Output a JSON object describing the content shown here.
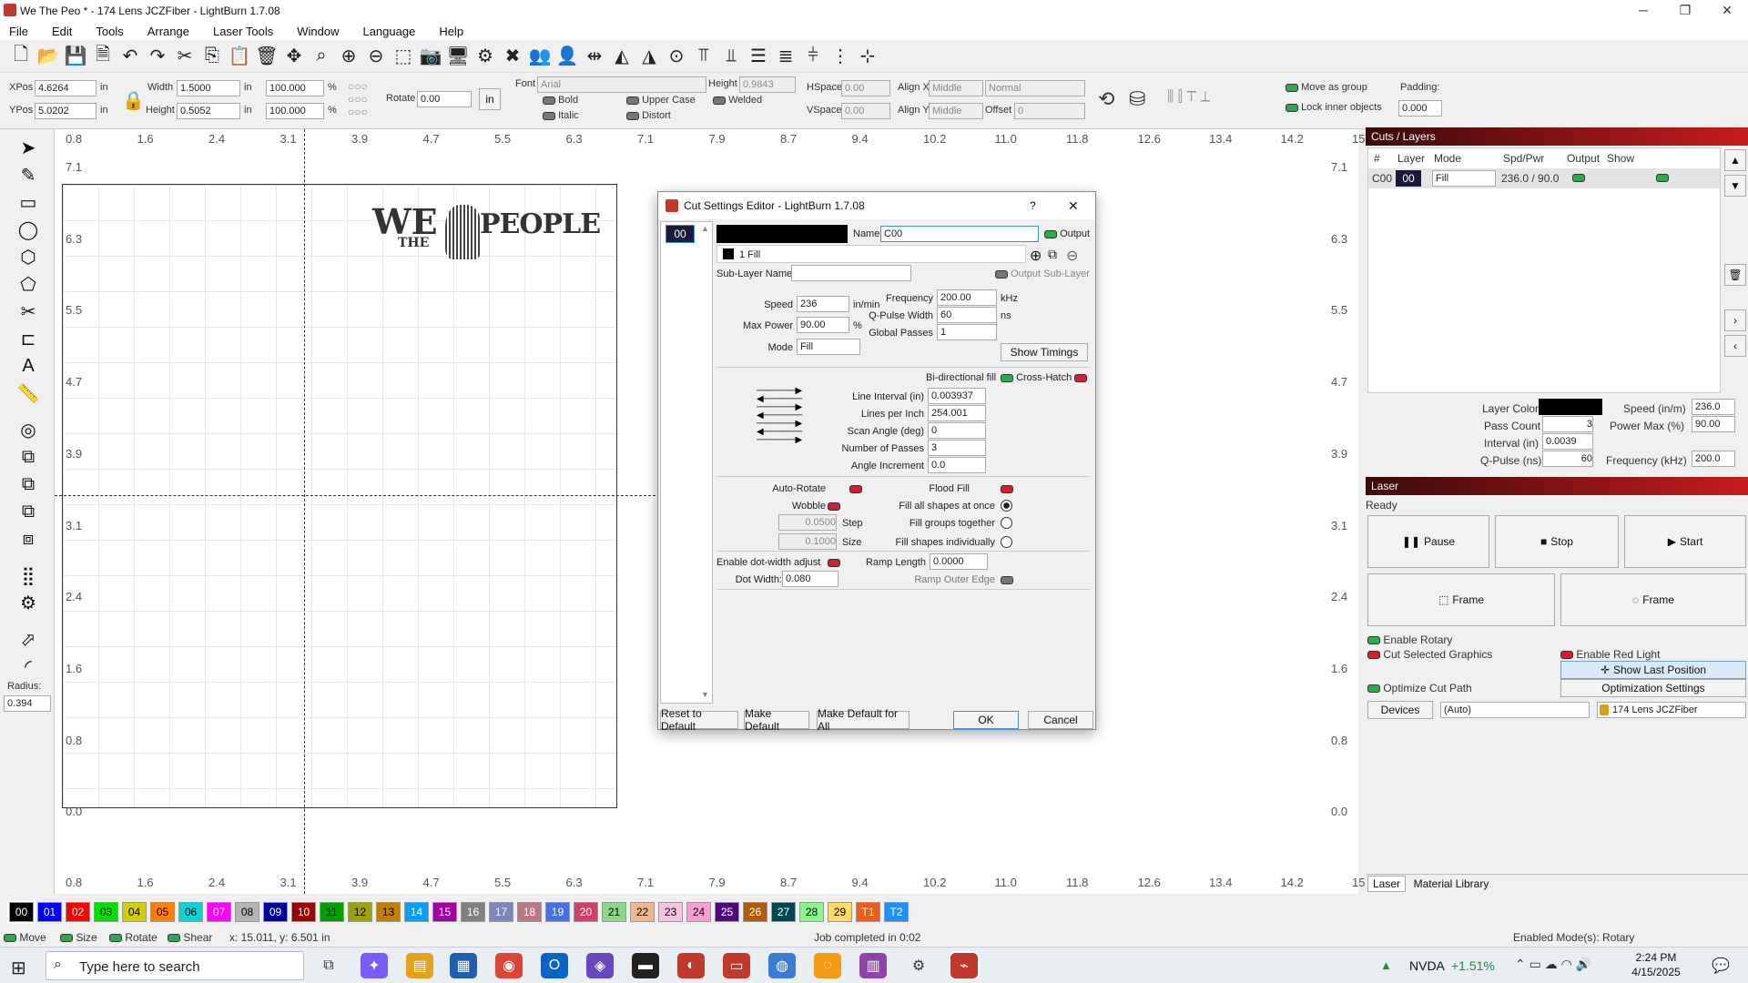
{
  "window": {
    "title": "We The Peo * - 174 Lens JCZFiber - LightBurn 1.7.08",
    "controls": [
      "─",
      "❐",
      "✕"
    ]
  },
  "menu": [
    "File",
    "Edit",
    "Tools",
    "Arrange",
    "Laser Tools",
    "Window",
    "Language",
    "Help"
  ],
  "props": {
    "xpos_label": "XPos",
    "xpos": "4.6264",
    "ypos_label": "YPos",
    "ypos": "5.0202",
    "unit": "in",
    "width_label": "Width",
    "width": "1.5000",
    "height_label": "Height",
    "height": "0.5052",
    "wpct": "100.000",
    "hpct": "100.000",
    "pct": "%",
    "rotate_label": "Rotate",
    "rotate": "0.00",
    "in_btn": "in",
    "font_label": "Font",
    "font": "Arial",
    "fheight_label": "Height",
    "fheight": "0.9843",
    "hspace_label": "HSpace",
    "hspace": "0.00",
    "vspace_label": "VSpace",
    "vspace": "0.00",
    "alignx_label": "Align X",
    "alignx": "Middle",
    "aligny_label": "Align Y",
    "aligny": "Middle",
    "normal": "Normal",
    "offset_label": "Offset",
    "offset": "0",
    "bold": "Bold",
    "italic": "Italic",
    "uppercase": "Upper Case",
    "distort": "Distort",
    "welded": "Welded",
    "move_group": "Move as group",
    "lock_inner": "Lock inner objects",
    "padding_label": "Padding:",
    "padding": "0.000"
  },
  "tools": {
    "radius_label": "Radius:",
    "radius": "0.394"
  },
  "ruler": {
    "top": [
      "0.8",
      "1.6",
      "2.4",
      "3.1",
      "3.9",
      "4.7",
      "5.5",
      "6.3",
      "7.1",
      "7.9",
      "8.7",
      "9.4",
      "10.2",
      "11.0",
      "11.8",
      "12.6",
      "13.4",
      "14.2",
      "15.0"
    ],
    "left": [
      "7.1",
      "6.3",
      "5.5",
      "4.7",
      "3.9",
      "3.1",
      "2.4",
      "1.6",
      "0.8",
      "0.0"
    ]
  },
  "canvas": {
    "logo_we": "WE",
    "logo_the": "THE",
    "logo_people": "PEOPLE"
  },
  "cuts": {
    "title": "Cuts / Layers",
    "headers": [
      "#",
      "Layer",
      "Mode",
      "Spd/Pwr",
      "Output",
      "Show"
    ],
    "row": {
      "num": "C00",
      "layer": "00",
      "mode": "Fill",
      "spdpwr": "236.0 / 90.0"
    },
    "layer_color_label": "Layer Color",
    "speed_label": "Speed (in/m)",
    "speed": "236.0",
    "pass_label": "Pass Count",
    "pass": "3",
    "powermax_label": "Power Max (%)",
    "powermax": "90.00",
    "interval_label": "Interval (in)",
    "interval": "0.0039",
    "qpulse_label": "Q-Pulse (ns)",
    "qpulse": "60",
    "freq_label": "Frequency (kHz)",
    "freq": "200.0"
  },
  "laser": {
    "title": "Laser",
    "status": "Ready",
    "pause": "Pause",
    "stop": "Stop",
    "start": "Start",
    "frame1": "Frame",
    "frame2": "Frame",
    "enable_rotary": "Enable Rotary",
    "cut_selected": "Cut Selected Graphics",
    "enable_red": "Enable Red Light",
    "show_last": "Show Last Position",
    "optimize": "Optimize Cut Path",
    "opt_settings": "Optimization Settings",
    "devices": "Devices",
    "auto": "(Auto)",
    "device": "174 Lens JCZFiber",
    "tab_laser": "Laser",
    "tab_material": "Material Library"
  },
  "dialog": {
    "title": "Cut Settings Editor - LightBurn 1.7.08",
    "help": "?",
    "close": "✕",
    "layer": "00",
    "name_label": "Name",
    "name": "C00",
    "output": "Output",
    "sublayer": "1 Fill",
    "sublayer_name_label": "Sub-Layer Name",
    "output_sublayer": "Output Sub-Layer",
    "speed_label": "Speed",
    "speed": "236",
    "speed_unit": "in/min",
    "maxpower_label": "Max Power",
    "maxpower": "90.00",
    "pct": "%",
    "mode_label": "Mode",
    "mode": "Fill",
    "freq_label": "Frequency",
    "freq": "200.00",
    "freq_unit": "kHz",
    "qpulse_label": "Q-Pulse Width",
    "qpulse": "60",
    "qpulse_unit": "ns",
    "global_label": "Global Passes",
    "global": "1",
    "show_timings": "Show Timings",
    "bidir": "Bi-directional fill",
    "crosshatch": "Cross-Hatch",
    "line_interval_label": "Line Interval (in)",
    "line_interval": "0.003937",
    "lpi_label": "Lines per Inch",
    "lpi": "254.001",
    "scan_label": "Scan Angle (deg)",
    "scan": "0",
    "passes_label": "Number of Passes",
    "passes": "3",
    "angle_inc_label": "Angle Increment",
    "angle_inc": "0.0",
    "autorotate": "Auto-Rotate",
    "floodfill": "Flood Fill",
    "wobble": "Wobble",
    "fill_all": "Fill all shapes at once",
    "step_val": "0.0500",
    "step": "Step",
    "fill_groups": "Fill groups together",
    "size_val": "0.1000",
    "size": "Size",
    "fill_indiv": "Fill shapes individually",
    "dotwidth_enable": "Enable dot-width adjust",
    "ramp_label": "Ramp Length",
    "ramp": "0.0000",
    "dotwidth_label": "Dot Width:",
    "dotwidth": "0.080",
    "ramp_outer": "Ramp Outer Edge",
    "reset": "Reset to Default",
    "make_default": "Make Default",
    "make_default_all": "Make Default for All",
    "ok": "OK",
    "cancel": "Cancel"
  },
  "palette": [
    {
      "l": "00",
      "c": "#000000",
      "t": "#fff"
    },
    {
      "l": "01",
      "c": "#0000ff",
      "t": "#fff"
    },
    {
      "l": "02",
      "c": "#ff0000",
      "t": "#fff"
    },
    {
      "l": "03",
      "c": "#00e000",
      "t": "#000"
    },
    {
      "l": "04",
      "c": "#d0d000",
      "t": "#000"
    },
    {
      "l": "05",
      "c": "#ff8000",
      "t": "#000"
    },
    {
      "l": "06",
      "c": "#00d8d8",
      "t": "#000"
    },
    {
      "l": "07",
      "c": "#ff00ff",
      "t": "#fff"
    },
    {
      "l": "08",
      "c": "#b4b4b4",
      "t": "#000"
    },
    {
      "l": "09",
      "c": "#0000a0",
      "t": "#fff"
    },
    {
      "l": "10",
      "c": "#a00000",
      "t": "#fff"
    },
    {
      "l": "11",
      "c": "#00a000",
      "t": "#000"
    },
    {
      "l": "12",
      "c": "#a0a000",
      "t": "#000"
    },
    {
      "l": "13",
      "c": "#c08000",
      "t": "#000"
    },
    {
      "l": "14",
      "c": "#00a0ff",
      "t": "#fff"
    },
    {
      "l": "15",
      "c": "#a000a0",
      "t": "#fff"
    },
    {
      "l": "16",
      "c": "#808080",
      "t": "#fff"
    },
    {
      "l": "17",
      "c": "#7d87b9",
      "t": "#fff"
    },
    {
      "l": "18",
      "c": "#bb7784",
      "t": "#fff"
    },
    {
      "l": "19",
      "c": "#4a6fe3",
      "t": "#fff"
    },
    {
      "l": "20",
      "c": "#d33f6a",
      "t": "#fff"
    },
    {
      "l": "21",
      "c": "#8cd78c",
      "t": "#000"
    },
    {
      "l": "22",
      "c": "#f0b98d",
      "t": "#000"
    },
    {
      "l": "23",
      "c": "#f6c4e1",
      "t": "#000"
    },
    {
      "l": "24",
      "c": "#fa9ed4",
      "t": "#000"
    },
    {
      "l": "25",
      "c": "#500a78",
      "t": "#fff"
    },
    {
      "l": "26",
      "c": "#b45a00",
      "t": "#fff"
    },
    {
      "l": "27",
      "c": "#004754",
      "t": "#fff"
    },
    {
      "l": "28",
      "c": "#86fa88",
      "t": "#000"
    },
    {
      "l": "29",
      "c": "#ffdb66",
      "t": "#000"
    },
    {
      "l": "T1",
      "c": "#f35c15",
      "t": "#fff"
    },
    {
      "l": "T2",
      "c": "#1e90ff",
      "t": "#fff"
    }
  ],
  "status": {
    "move": "Move",
    "size": "Size",
    "rotate": "Rotate",
    "shear": "Shear",
    "coords": "x: 15.011, y: 6.501 in",
    "job": "Job completed in 0:02",
    "modes": "Enabled Mode(s): Rotary"
  },
  "taskbar": {
    "search": "Type here to search",
    "stock": "NVDA",
    "change": "+1.51%",
    "time": "2:24 PM",
    "date": "4/15/2025"
  }
}
